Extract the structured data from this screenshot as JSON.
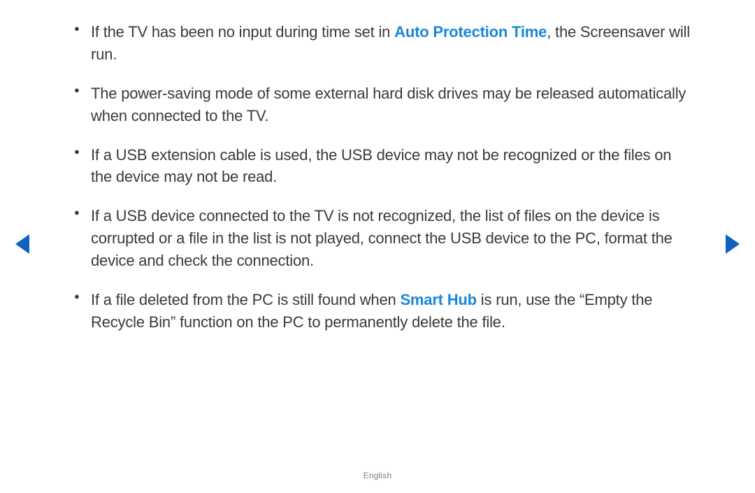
{
  "bullets": [
    {
      "before": "If the TV has been no input during time set in ",
      "highlight": "Auto Protection Time",
      "after": ", the Screensaver will run."
    },
    {
      "before": "The power-saving mode of some external hard disk drives may be released automatically when connected to the TV.",
      "highlight": "",
      "after": ""
    },
    {
      "before": "If a USB extension cable is used, the USB device may not be recognized or the files on the device may not be read.",
      "highlight": "",
      "after": ""
    },
    {
      "before": "If a USB device connected to the TV is not recognized, the list of files on the device is corrupted or a file in the list is not played, connect the USB device to the PC, format the device and check the connection.",
      "highlight": "",
      "after": ""
    },
    {
      "before": "If a file deleted from the PC is still found when ",
      "highlight": "Smart Hub",
      "after": " is run, use the “Empty the Recycle Bin” function on the PC to permanently delete the file."
    }
  ],
  "footer": {
    "language": "English"
  }
}
